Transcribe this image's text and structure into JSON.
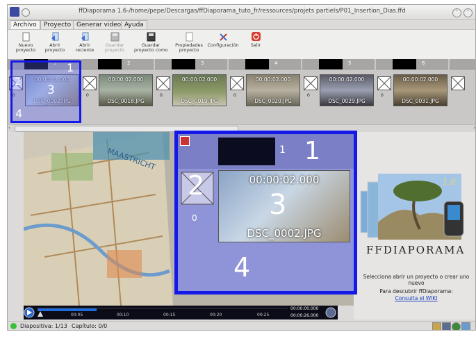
{
  "window": {
    "title": "ffDiaporama 1.6-/home/pepe/Descargas/ffDiaporama_tuto_fr/ressources/projets partiels/P01_Insertion_Dias.ffd"
  },
  "menu": {
    "tabs": [
      "Archivo",
      "Proyecto",
      "Generar video",
      "Ayuda"
    ],
    "active": "Archivo"
  },
  "toolbar": {
    "nuevo": "Nuevo\nproyecto",
    "abrir": "Abrir\nproyecto",
    "abrir_reciente": "Abrir\nreciente",
    "guardar": "Guardar\nproyecto",
    "guardar_como": "Guardar\nproyecto como",
    "propiedades": "Propiedades\nproyecto",
    "configuracion": "Configuración",
    "salir": "Salir"
  },
  "timeline": {
    "slides": [
      {
        "number": "1",
        "timecode": "00:00:02.000",
        "file": "DSC_0002.JPG",
        "transition_value": "0"
      },
      {
        "number": "2",
        "timecode": "00:00:02.000",
        "file": "DSC_0018.JPG",
        "transition_value": "0"
      },
      {
        "number": "3",
        "timecode": "00:00:02.000",
        "file": "DSC_0019.JPG",
        "transition_value": "0"
      },
      {
        "number": "4",
        "timecode": "00:00:02.000",
        "file": "DSC_0020.JPG",
        "transition_value": "0"
      },
      {
        "number": "5",
        "timecode": "00:00:02.000",
        "file": "DSC_0029.JPG",
        "transition_value": "0"
      },
      {
        "number": "6",
        "timecode": "00:00:02.000",
        "file": "DSC_0031.JPG",
        "transition_value": "0"
      }
    ]
  },
  "annotations": {
    "labels": [
      "1",
      "2",
      "3",
      "4"
    ]
  },
  "zoom_view": {
    "number": "1",
    "transition_value": "0",
    "timecode": "00:00:02.000",
    "file": "DSC_0002.JPG"
  },
  "player": {
    "ticks": [
      "00:05",
      "00:10",
      "00:15",
      "00:20",
      "00:25"
    ],
    "current_time": "00:00:00.000",
    "total_time": "00:00:26.000"
  },
  "right_panel": {
    "version": "1.6",
    "logo": "FFDIAPORAMA",
    "message": "Selecciona abrir un proyecto o crear uno nuevo",
    "message2": "Para descubrir ffDiaporama:",
    "link": "Consulta el WIKI"
  },
  "status": {
    "slide": "Diapositiva: 1/13",
    "chapter": "Capítulo: 0/0"
  },
  "colors": {
    "accent": "#1418e8",
    "link": "#1a3fc0"
  }
}
